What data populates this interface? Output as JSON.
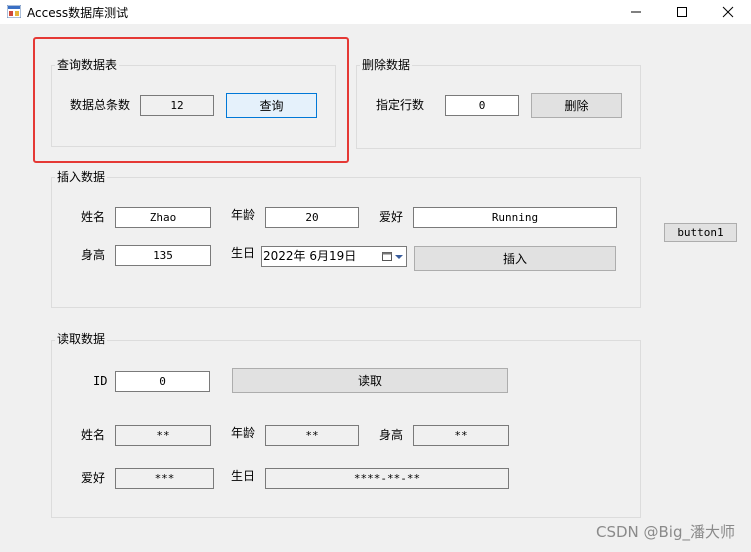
{
  "window": {
    "title": "Access数据库测试"
  },
  "query_group": {
    "title": "查询数据表",
    "count_label": "数据总条数",
    "count_value": "12",
    "query_button": "查询"
  },
  "delete_group": {
    "title": "删除数据",
    "row_label": "指定行数",
    "row_value": "0",
    "delete_button": "删除"
  },
  "insert_group": {
    "title": "插入数据",
    "name_label": "姓名",
    "name_value": "Zhao",
    "age_label": "年龄",
    "age_value": "20",
    "hobby_label": "爱好",
    "hobby_value": "Running",
    "height_label": "身高",
    "height_value": "135",
    "birthday_label": "生日",
    "birthday_value": "2022年  6月19日",
    "insert_button": "插入"
  },
  "side_button": "button1",
  "read_group": {
    "title": "读取数据",
    "id_label": "ID",
    "id_value": "0",
    "read_button": "读取",
    "name_label": "姓名",
    "name_value": "**",
    "age_label": "年龄",
    "age_value": "**",
    "height_label": "身高",
    "height_value": "**",
    "hobby_label": "爱好",
    "hobby_value": "***",
    "birthday_label": "生日",
    "birthday_value": "****-**-**"
  },
  "watermark": "CSDN @Big_潘大师",
  "colors": {
    "highlight": "#e53935",
    "focus": "#0078d7"
  }
}
